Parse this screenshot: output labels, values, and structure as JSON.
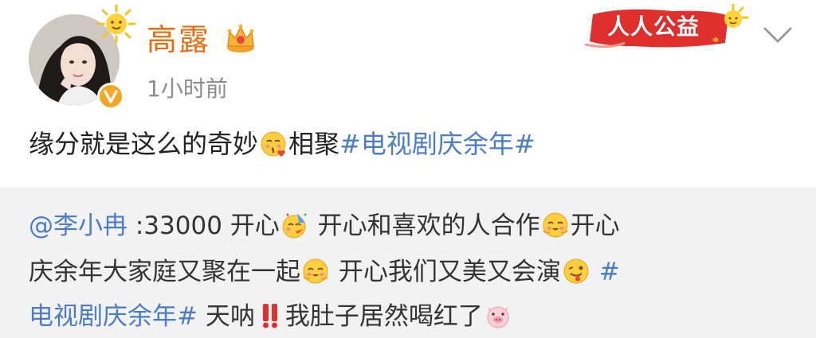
{
  "user": {
    "name": "高露",
    "time": "1小时前"
  },
  "badge": {
    "charity_label": "人人公益"
  },
  "post": {
    "text_part1": "缘分就是这么的奇妙",
    "text_part2": "相聚",
    "hashtag": "#电视剧庆余年#"
  },
  "repost": {
    "mention": "@李小冉",
    "line1_a": " :33000 开心",
    "line1_b": " 开心和喜欢的人合作",
    "line1_c": "开心",
    "line2_a": "庆余年大家庭又聚在一起",
    "line2_b": " 开心我们又美又会演",
    "line2_hash": " #",
    "line3_hash": "电视剧庆余年#",
    "line3_a": " 天呐",
    "line3_b": "我肚子居然喝红了"
  },
  "colors": {
    "username": "#e86b0c",
    "link": "#4a7cc7",
    "text": "#222222",
    "muted": "#8c8c8c",
    "repost_bg": "#f2f2f2",
    "verified": "#f5a623",
    "charity": "#e0302e"
  },
  "icons": [
    "sun-icon",
    "verified-v-icon",
    "crown-icon",
    "charity-sun-icon",
    "chevron-down-icon",
    "kiss-emoji-icon",
    "party-emoji-icon",
    "happy-emoji-icon",
    "tongue-emoji-icon",
    "double-exclamation-icon",
    "pig-emoji-icon"
  ]
}
